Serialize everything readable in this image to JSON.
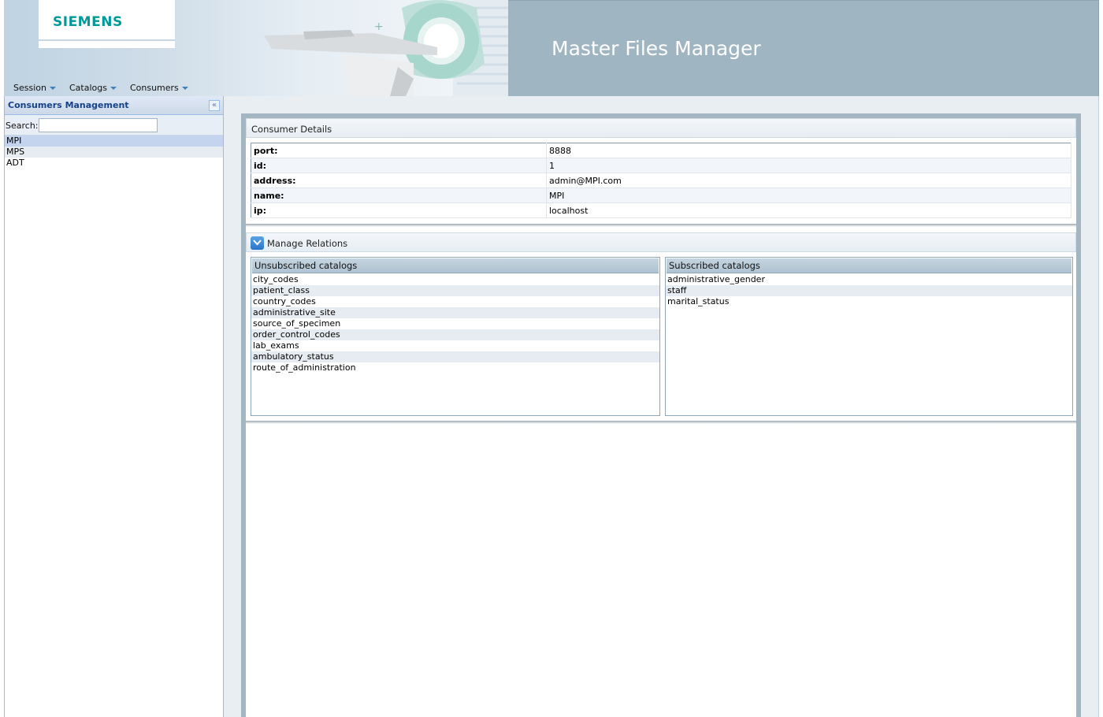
{
  "header": {
    "logo_text": "SIEMENS",
    "app_title": "Master Files Manager"
  },
  "menu": {
    "items": [
      {
        "label": "Session"
      },
      {
        "label": "Catalogs"
      },
      {
        "label": "Consumers"
      }
    ]
  },
  "sidebar": {
    "title": "Consumers Management",
    "search_label": "Search:",
    "search_value": "",
    "consumers": [
      "MPI",
      "MPS",
      "ADT"
    ],
    "selected": "MPI"
  },
  "details": {
    "title": "Consumer Details",
    "rows": [
      {
        "key": "port:",
        "value": "8888"
      },
      {
        "key": "id:",
        "value": "1"
      },
      {
        "key": "address:",
        "value": "admin@MPI.com"
      },
      {
        "key": "name:",
        "value": "MPI"
      },
      {
        "key": "ip:",
        "value": "localhost"
      }
    ]
  },
  "relations": {
    "title": "Manage Relations",
    "unsubscribed": {
      "header": "Unsubscribed catalogs",
      "items": [
        "city_codes",
        "patient_class",
        "country_codes",
        "administrative_site",
        "source_of_specimen",
        "order_control_codes",
        "lab_exams",
        "ambulatory_status",
        "route_of_administration"
      ]
    },
    "subscribed": {
      "header": "Subscribed catalogs",
      "items": [
        "administrative_gender",
        "staff",
        "marital_status"
      ]
    }
  },
  "colors": {
    "brand": "#009999",
    "header_bg": "#a0b5c2",
    "sidebar_title": "#15428b",
    "selection": "#c4d4ee"
  }
}
